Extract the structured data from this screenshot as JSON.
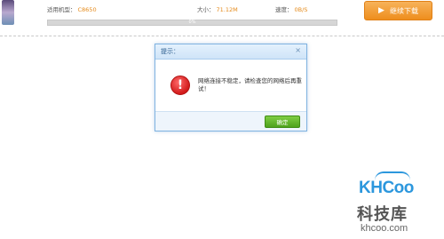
{
  "download_bar": {
    "model_label": "适用机型：",
    "model_value": "C8650",
    "size_label": "大小：",
    "size_value": "71.12M",
    "speed_label": "速度：",
    "speed_value": "0B/S",
    "progress_text": "0%",
    "progress": 0.0,
    "continue_button": "继续下载"
  },
  "dialog": {
    "title": "提示：",
    "close": "×",
    "icon": "error-icon",
    "message": "网络连接不稳定，请检查您的网络后再重试！",
    "ok_button": "确定"
  },
  "watermark": {
    "brand": "KHCoo",
    "brand_cn": "科技库",
    "url": "khcoo.com"
  },
  "colors": {
    "accent_orange": "#ee8e1d",
    "ok_green": "#4ea21c",
    "dialog_border": "#7fb2e0",
    "error_red": "#d21b1b",
    "brand_blue": "#2c97dd"
  }
}
